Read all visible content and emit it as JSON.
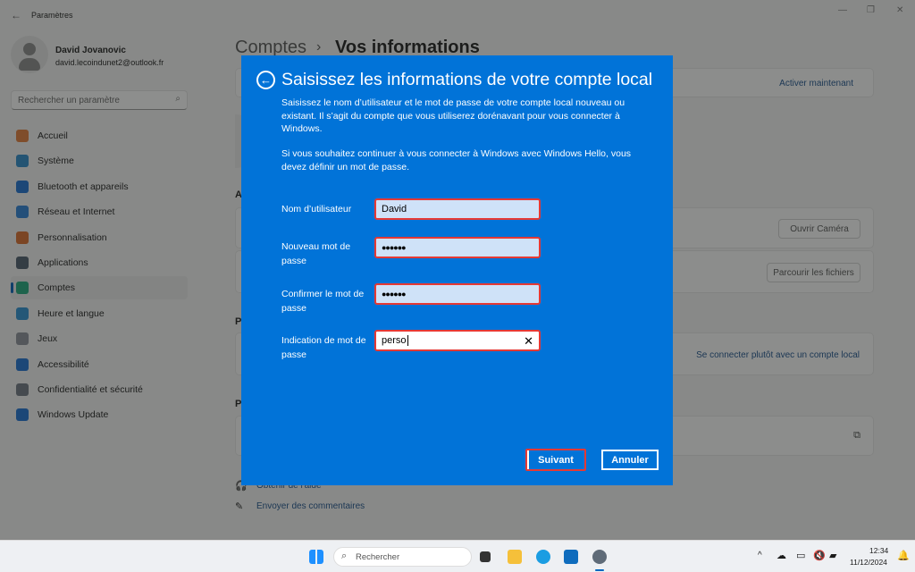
{
  "window": {
    "title": "Paramètres"
  },
  "user": {
    "name": "David Jovanovic",
    "email": "david.lecoindunet2@outlook.fr"
  },
  "search": {
    "placeholder": "Rechercher un paramètre"
  },
  "sidebar": {
    "items": [
      {
        "label": "Accueil",
        "icon": "home-icon",
        "color": "#e07b39"
      },
      {
        "label": "Système",
        "icon": "system-icon",
        "color": "#2a88c8"
      },
      {
        "label": "Bluetooth et appareils",
        "icon": "bluetooth-icon",
        "color": "#1a6fd0"
      },
      {
        "label": "Réseau et Internet",
        "icon": "wifi-icon",
        "color": "#2b7fd4"
      },
      {
        "label": "Personnalisation",
        "icon": "brush-icon",
        "color": "#d86a2a"
      },
      {
        "label": "Applications",
        "icon": "apps-icon",
        "color": "#4a5a6a"
      },
      {
        "label": "Comptes",
        "icon": "account-icon",
        "color": "#1fa67a",
        "active": true
      },
      {
        "label": "Heure et langue",
        "icon": "clock-globe-icon",
        "color": "#2b8fd0"
      },
      {
        "label": "Jeux",
        "icon": "gamepad-icon",
        "color": "#8a8f99"
      },
      {
        "label": "Accessibilité",
        "icon": "accessibility-icon",
        "color": "#1a6fd0"
      },
      {
        "label": "Confidentialité et sécurité",
        "icon": "shield-icon",
        "color": "#6d7580"
      },
      {
        "label": "Windows Update",
        "icon": "update-icon",
        "color": "#1a6fd0"
      }
    ]
  },
  "main": {
    "breadcrumb_parent": "Comptes",
    "breadcrumb_sep": "›",
    "breadcrumb_current": "Vos informations",
    "activate_link": "Activer maintenant",
    "section_a": "A",
    "open_camera": "Ouvrir Caméra",
    "browse_files": "Parcourir les fichiers",
    "section_p1": "P",
    "local_account_link": "Se connecter plutôt avec un compte local",
    "section_p2": "P",
    "help_link": "Obtenir de l'aide",
    "feedback_link": "Envoyer des commentaires"
  },
  "dialog": {
    "title": "Saisissez les informations de votre compte local",
    "para1": "Saisissez le nom d’utilisateur et le mot de passe de votre compte local nouveau ou existant. Il s’agit du compte que vous utiliserez dorénavant pour vous connecter à Windows.",
    "para2": "Si vous souhaitez continuer à vous connecter à Windows avec Windows Hello, vous devez définir un mot de passe.",
    "fields": [
      {
        "label": "Nom d’utilisateur",
        "value": "David"
      },
      {
        "label": "Nouveau mot de passe",
        "value": "●●●●●●"
      },
      {
        "label": "Confirmer le mot de passe",
        "value": "●●●●●●"
      },
      {
        "label": "Indication de mot de passe",
        "value": "perso"
      }
    ],
    "clear": "✕",
    "next": "Suivant",
    "cancel": "Annuler",
    "accent": "#0173d8",
    "highlight": "#e53935"
  },
  "taskbar": {
    "search": "Rechercher",
    "time": "12:34",
    "date": "11/12/2024"
  }
}
